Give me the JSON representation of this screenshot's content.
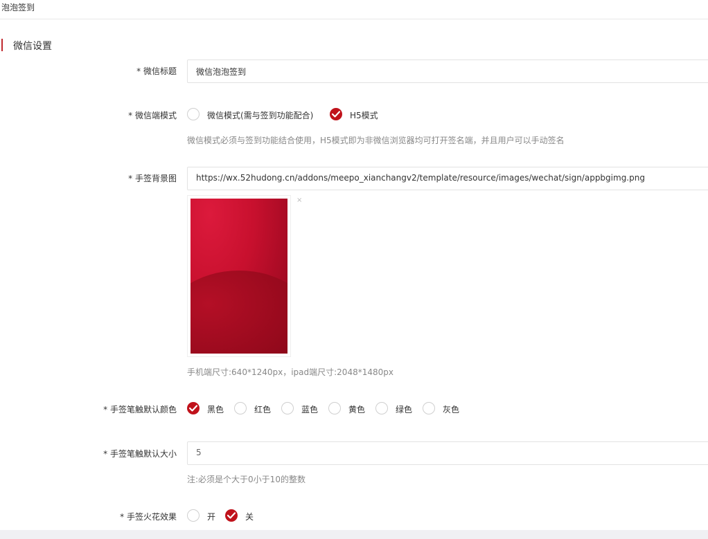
{
  "page": {
    "title": "泡泡签到"
  },
  "section": {
    "title": "微信设置"
  },
  "form": {
    "wechat_title": {
      "label": "* 微信标题",
      "value": "微信泡泡签到"
    },
    "wechat_mode": {
      "label": "* 微信端模式",
      "options": [
        {
          "label": "微信模式(需与签到功能配合)",
          "checked": false
        },
        {
          "label": "H5模式",
          "checked": true
        }
      ],
      "hint": "微信模式必须与签到功能结合使用，H5模式即为非微信浏览器均可打开签名端，并且用户可以手动签名"
    },
    "sign_bg": {
      "label": "* 手签背景图",
      "value": "https://wx.52hudong.cn/addons/meepo_xianchangv2/template/resource/images/wechat/sign/appbgimg.png",
      "remove_icon": "close-icon",
      "hint": "手机端尺寸:640*1240px，ipad端尺寸:2048*1480px"
    },
    "pen_color": {
      "label": "* 手签笔触默认颜色",
      "options": [
        {
          "label": "黑色",
          "checked": true
        },
        {
          "label": "红色",
          "checked": false
        },
        {
          "label": "蓝色",
          "checked": false
        },
        {
          "label": "黄色",
          "checked": false
        },
        {
          "label": "绿色",
          "checked": false
        },
        {
          "label": "灰色",
          "checked": false
        }
      ]
    },
    "pen_size": {
      "label": "* 手签笔触默认大小",
      "value": "5",
      "hint": "注:必须是个大于0小于10的整数"
    },
    "sparkle": {
      "label": "* 手签火花效果",
      "options": [
        {
          "label": "开",
          "checked": false
        },
        {
          "label": "关",
          "checked": true
        }
      ]
    }
  },
  "colors": {
    "accent": "#c0121b",
    "section_bar": "#c0282d"
  }
}
